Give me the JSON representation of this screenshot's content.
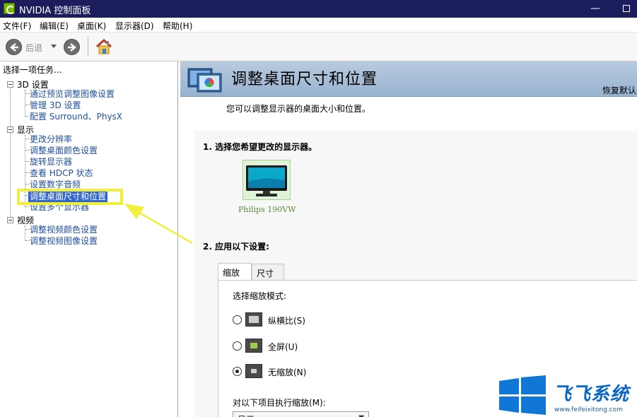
{
  "window": {
    "title": "NVIDIA 控制面板",
    "minimize_label": "—"
  },
  "menubar": {
    "items": [
      {
        "label": "文件(F)"
      },
      {
        "label": "编辑(E)"
      },
      {
        "label": "桌面(K)"
      },
      {
        "label": "显示器(D)"
      },
      {
        "label": "帮助(H)"
      }
    ]
  },
  "toolbar": {
    "back_label": "后退"
  },
  "sidebar": {
    "header": "选择一项任务...",
    "categories": [
      {
        "label": "3D 设置",
        "items": [
          {
            "label": "通过预览调整图像设置"
          },
          {
            "label": "管理 3D 设置"
          },
          {
            "label": "配置 Surround、PhysX"
          }
        ]
      },
      {
        "label": "显示",
        "items": [
          {
            "label": "更改分辨率"
          },
          {
            "label": "调整桌面颜色设置"
          },
          {
            "label": "旋转显示器"
          },
          {
            "label": "查看 HDCP 状态"
          },
          {
            "label": "设置数字音频"
          },
          {
            "label": "调整桌面尺寸和位置",
            "selected": true
          },
          {
            "label": "设置多个显示器"
          }
        ]
      },
      {
        "label": "视频",
        "items": [
          {
            "label": "调整视频颜色设置"
          },
          {
            "label": "调整视频图像设置"
          }
        ]
      }
    ]
  },
  "main": {
    "title": "调整桌面尺寸和位置",
    "restore_label": "恢复默认",
    "description": "您可以调整显示器的桌面大小和位置。",
    "step1": {
      "label": "1. 选择您希望更改的显示器。"
    },
    "monitor": {
      "name": "Philips 190VW"
    },
    "step2": {
      "label": "2. 应用以下设置:"
    },
    "tabs": [
      {
        "label": "缩放",
        "active": true
      },
      {
        "label": "尺寸"
      }
    ],
    "scaling_mode_label": "选择缩放模式:",
    "modes": [
      {
        "label": "纵横比(S)",
        "icon": "aspect-ratio-icon",
        "checked": false
      },
      {
        "label": "全屏(U)",
        "icon": "fullscreen-icon",
        "checked": false
      },
      {
        "label": "无缩放(N)",
        "icon": "no-scaling-icon",
        "checked": true
      }
    ],
    "perform_scaling_label": "对以下项目执行缩放(M):",
    "perform_scaling_value": "显示"
  },
  "watermark": {
    "brand": "飞飞系统",
    "url": "www.feifeixitong.com"
  },
  "colors": {
    "titlebar": "#1c1d5c",
    "link": "#1f4f9c",
    "selected": "#3366cc",
    "nvidia_green": "#76b900",
    "highlight": "#f0f03c"
  }
}
